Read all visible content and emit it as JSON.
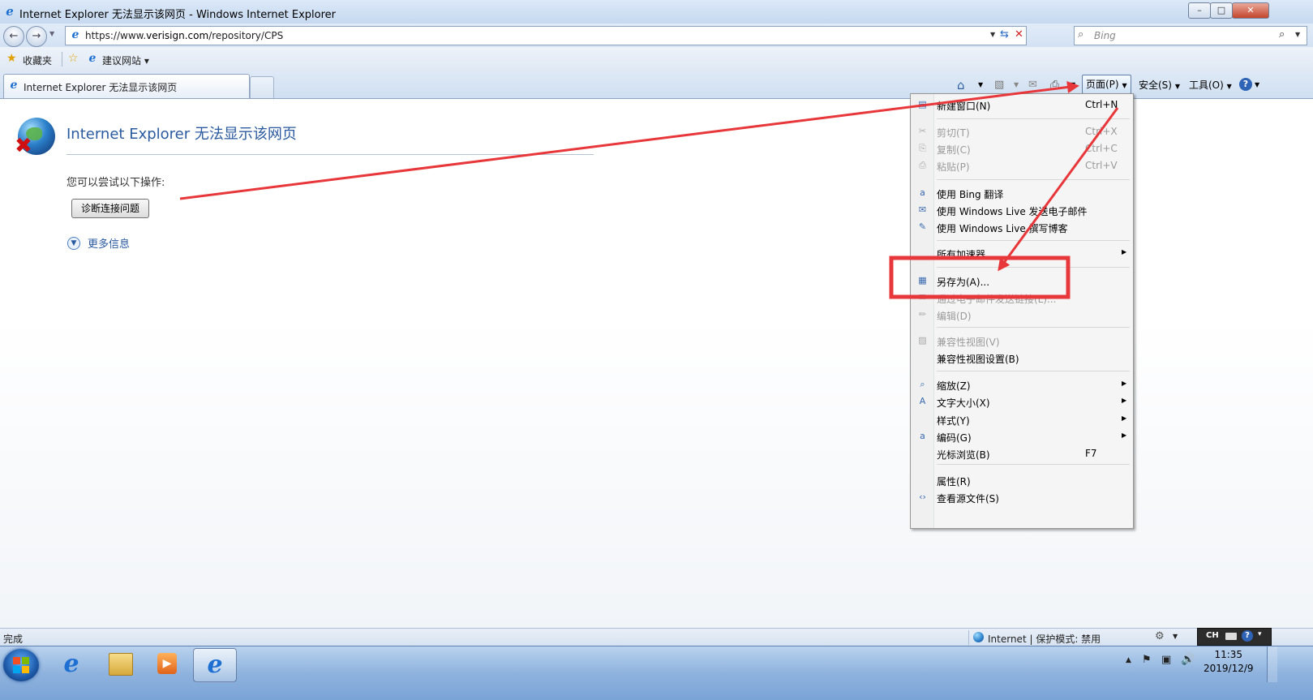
{
  "window": {
    "title": "Internet Explorer 无法显示该网页 - Windows Internet Explorer"
  },
  "address_bar": {
    "url_prefix": "https://www.",
    "url_host": "verisign.com",
    "url_path": "/repository/CPS"
  },
  "search_box": {
    "placeholder": "Bing"
  },
  "favorites_bar": {
    "favorites_label": "收藏夹",
    "suggested_sites_label": "建议网站"
  },
  "tab": {
    "title": "Internet Explorer 无法显示该网页"
  },
  "command_bar": {
    "page_label": "页面(P)",
    "safety_label": "安全(S)",
    "tools_label": "工具(O)"
  },
  "content": {
    "heading": "Internet Explorer 无法显示该网页",
    "try_text": "您可以尝试以下操作:",
    "diagnose_button": "诊断连接问题",
    "more_info": "更多信息"
  },
  "menu": {
    "items": [
      {
        "label": "新建窗口(N)",
        "shortcut": "Ctrl+N",
        "icon": "new-window-icon",
        "disabled": false
      },
      {
        "label": "剪切(T)",
        "shortcut": "Ctrl+X",
        "icon": "cut-icon",
        "disabled": true
      },
      {
        "label": "复制(C)",
        "shortcut": "Ctrl+C",
        "icon": "copy-icon",
        "disabled": true
      },
      {
        "label": "粘贴(P)",
        "shortcut": "Ctrl+V",
        "icon": "paste-icon",
        "disabled": true
      },
      {
        "label": "使用 Bing 翻译",
        "icon": "translate-icon",
        "disabled": false
      },
      {
        "label": "使用 Windows Live 发送电子邮件",
        "icon": "email-icon",
        "disabled": false
      },
      {
        "label": "使用 Windows Live 撰写博客",
        "icon": "blog-icon",
        "disabled": false
      },
      {
        "label": "所有加速器",
        "icon": "",
        "disabled": false,
        "submenu": true
      },
      {
        "label": "另存为(A)...",
        "icon": "save-icon",
        "disabled": false
      },
      {
        "label": "通过电子邮件发送链接(L)...",
        "icon": "email-link-icon",
        "disabled": true
      },
      {
        "label": "编辑(D)",
        "icon": "edit-icon",
        "disabled": true
      },
      {
        "label": "兼容性视图(V)",
        "icon": "compat-view-icon",
        "disabled": true
      },
      {
        "label": "兼容性视图设置(B)",
        "icon": "",
        "disabled": false
      },
      {
        "label": "缩放(Z)",
        "icon": "zoom-icon",
        "disabled": false,
        "submenu": true
      },
      {
        "label": "文字大小(X)",
        "icon": "text-size-icon",
        "disabled": false,
        "submenu": true
      },
      {
        "label": "样式(Y)",
        "icon": "",
        "disabled": false,
        "submenu": true
      },
      {
        "label": "编码(G)",
        "icon": "encoding-icon",
        "disabled": false,
        "submenu": true
      },
      {
        "label": "光标浏览(B)",
        "shortcut": "F7",
        "icon": "",
        "disabled": false
      },
      {
        "label": "属性(R)",
        "icon": "",
        "disabled": false
      },
      {
        "label": "查看源文件(S)",
        "icon": "view-source-icon",
        "disabled": false
      }
    ]
  },
  "status_bar": {
    "left_text": "完成",
    "zone_text": "Internet | 保护模式: 禁用"
  },
  "taskbar": {
    "lang": "CH",
    "time": "11:35",
    "date": "2019/12/9"
  },
  "annotation": {
    "color": "#e8373a"
  }
}
